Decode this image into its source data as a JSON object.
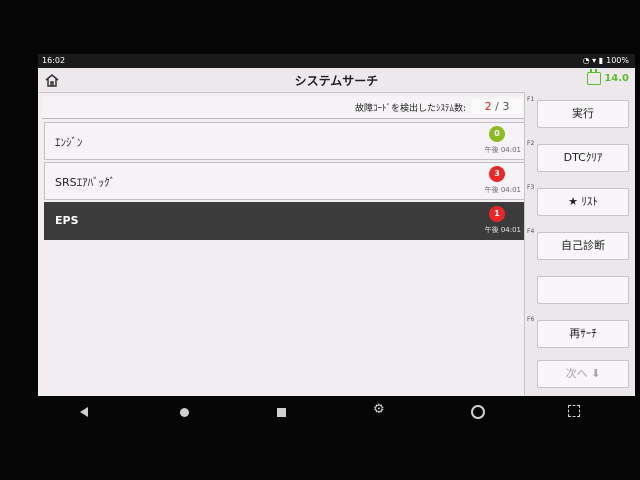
{
  "status": {
    "time": "16:02",
    "battery": "100%"
  },
  "header": {
    "title": "システムサーチ",
    "battery_value": "14.0"
  },
  "summary": {
    "label": "故障ｺｰﾄﾞを検出したｼｽﾃﾑ数:",
    "detected": "2",
    "separator": "/",
    "total": "3"
  },
  "systems": [
    {
      "name": "ｴﾝｼﾞﾝ",
      "count": "0",
      "status": "ok",
      "time": "午後 04:01"
    },
    {
      "name": "SRSｴｱﾊﾞｯｸﾞ",
      "count": "3",
      "status": "error",
      "time": "午後 04:01"
    },
    {
      "name": "EPS",
      "count": "1",
      "status": "error",
      "time": "午後 04:01",
      "selected": true
    }
  ],
  "function_keys": [
    {
      "key": "F1",
      "label": "実行"
    },
    {
      "key": "F2",
      "label": "DTCｸﾘｱ"
    },
    {
      "key": "F3",
      "label": "★ ﾘｽﾄ"
    },
    {
      "key": "F4",
      "label": "自己診断"
    },
    {
      "key": "",
      "label": ""
    },
    {
      "key": "F6",
      "label": "再ｻｰﾁ"
    },
    {
      "key": "",
      "label": "次へ ⬇"
    }
  ],
  "colors": {
    "ok": "#8bbc26",
    "error": "#e82828",
    "accent": "#5cbc2c",
    "selected_row": "#3b3b3b"
  },
  "icons": [
    "home-icon",
    "battery-icon",
    "back-icon",
    "home-circle-icon",
    "recent-apps-icon",
    "gear-icon",
    "chrome-icon",
    "screenshot-icon"
  ]
}
